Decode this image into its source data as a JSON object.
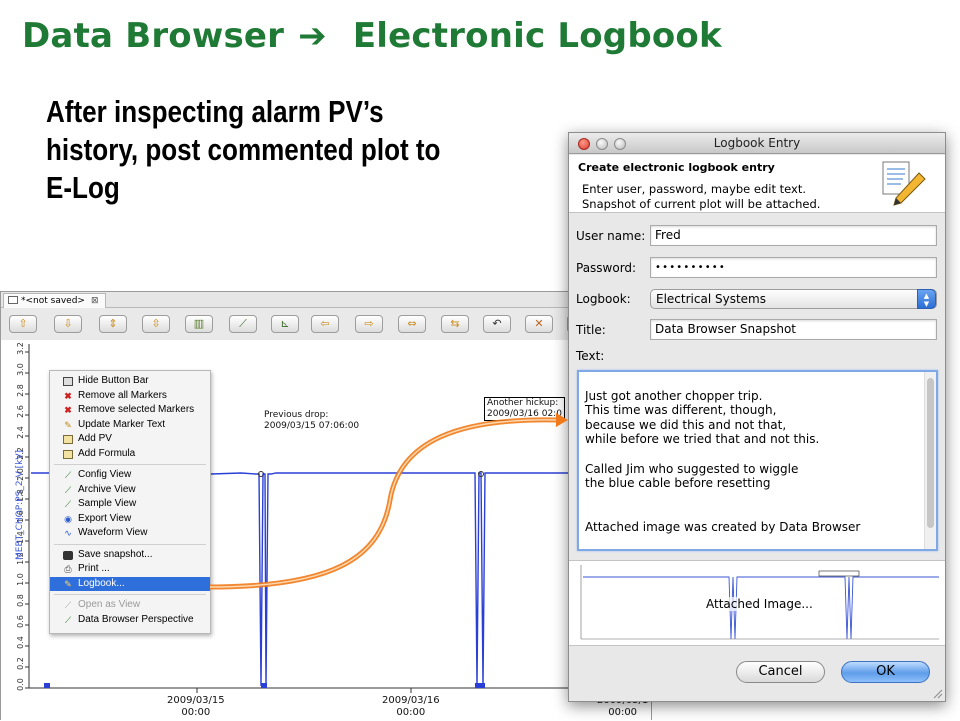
{
  "slide": {
    "title_left": "Data Browser",
    "arrow": "➔",
    "title_right": "Electronic Logbook",
    "bullet": "After inspecting alarm PV’s history, post commented plot to E-Log"
  },
  "data_browser": {
    "tab_title": "*<not saved>",
    "tab_close": "⊠",
    "toolbar_icons": [
      "up-arrow-icon",
      "down-arrow-icon",
      "zoom-in-y-icon",
      "zoom-out-y-icon",
      "stagger-icon",
      "auto-scale-icon",
      "trace-icon",
      "left-arrow-icon",
      "right-arrow-icon",
      "zoom-in-x-icon",
      "zoom-out-x-icon",
      "undo-icon",
      "cross-icon",
      "redo-icon"
    ],
    "y_axis_label": "MEBT_CHOP:PS_2:V [kV]",
    "y_ticks": [
      "0.0",
      "0.2",
      "0.4",
      "0.6",
      "0.8",
      "1.0",
      "1.2",
      "1.4",
      "1.6",
      "1.8",
      "2.0",
      "2.2",
      "2.4",
      "2.6",
      "2.8",
      "3.0",
      "3.2"
    ],
    "x_ticks": [
      {
        "date": "2009/03/15",
        "time": "00:00"
      },
      {
        "date": "2009/03/16",
        "time": "00:00"
      },
      {
        "date": "2009/03/1",
        "time": "00:00"
      }
    ],
    "annotation_1": {
      "line1": "Previous drop:",
      "line2": "2009/03/15 07:06:00"
    },
    "annotation_2": {
      "line1": "Another hickup:",
      "line2": "2009/03/16 02:0"
    },
    "context_menu": {
      "items_group1": [
        {
          "label": "Hide Button Bar",
          "icon": "button-bar-icon"
        },
        {
          "label": "Remove all Markers",
          "icon": "red-x-icon"
        },
        {
          "label": "Remove selected Markers",
          "icon": "red-x-icon"
        },
        {
          "label": "Update Marker Text",
          "icon": "pencil-icon"
        },
        {
          "label": "Add PV",
          "icon": "add-pv-icon"
        },
        {
          "label": "Add Formula",
          "icon": "formula-icon"
        }
      ],
      "items_group2": [
        {
          "label": "Config View",
          "icon": "chart-icon"
        },
        {
          "label": "Archive View",
          "icon": "archive-icon"
        },
        {
          "label": "Sample View",
          "icon": "sample-icon"
        },
        {
          "label": "Export View",
          "icon": "export-icon"
        },
        {
          "label": "Waveform View",
          "icon": "waveform-icon"
        }
      ],
      "items_group3": [
        {
          "label": "Save snapshot...",
          "icon": "camera-icon"
        },
        {
          "label": "Print ...",
          "icon": "printer-icon"
        },
        {
          "label": "Logbook...",
          "icon": "logbook-pencil-icon",
          "selected": true
        }
      ],
      "items_group4": [
        {
          "label": "Open as View",
          "icon": "chart-icon",
          "disabled": true
        },
        {
          "label": "Data Browser Perspective",
          "icon": "perspective-icon"
        }
      ]
    }
  },
  "logbook_dialog": {
    "window_title": "Logbook Entry",
    "header_title": "Create electronic logbook entry",
    "header_desc": "Enter user, password, maybe edit text.\nSnapshot of current plot will be attached.",
    "user_label": "User name:",
    "user_value": "Fred",
    "password_label": "Password:",
    "password_value": "••••••••••",
    "logbook_label": "Logbook:",
    "logbook_value": "Electrical Systems",
    "title_label": "Title:",
    "title_value": "Data Browser Snapshot",
    "text_label": "Text:",
    "text_value": "Just got another chopper trip.\nThis time was different, though,\nbecause we did this and not that,\nwhile before we tried that and not this.\n\nCalled Jim who suggested to wiggle\nthe blue cable before resetting\n\n\nAttached image was created by Data Browser",
    "image_caption": "Attached Image...",
    "cancel_label": "Cancel",
    "ok_label": "OK",
    "colors": {
      "ok_button": "#5f9de9",
      "close_button": "#d8392b"
    }
  },
  "colors": {
    "title_green": "#1e7a34",
    "trace_blue": "#2a3fd6",
    "connector_orange": "#f07a1a",
    "menu_highlight": "#2f6fdc"
  }
}
